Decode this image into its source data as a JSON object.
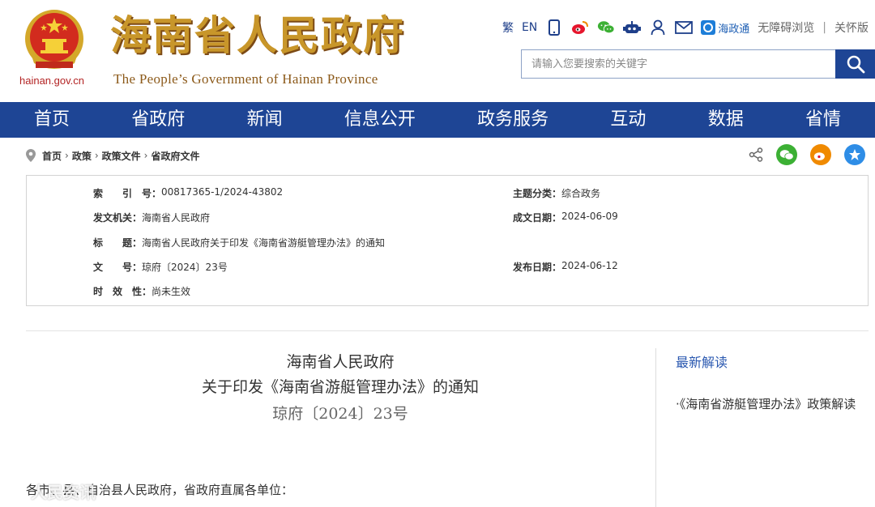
{
  "header": {
    "domain": "hainan.gov.cn",
    "title": "海南省人民政府",
    "subtitle": "The People’s Government  of Hainan Province",
    "tools": {
      "traditional": "繁",
      "english": "EN",
      "haizhengtong": "海政通",
      "accessibility": "无障碍浏览",
      "separator": "|",
      "elder_mode": "关怀版"
    },
    "search": {
      "placeholder": "请输入您要搜索的关键字"
    }
  },
  "nav": [
    "首页",
    "省政府",
    "新闻",
    "信息公开",
    "政务服务",
    "互动",
    "数据",
    "省情"
  ],
  "breadcrumb": [
    "首页",
    "政策",
    "政策文件",
    "省政府文件"
  ],
  "info": {
    "index_label": "索　　引　号：",
    "index_value": "00817365-1/2024-43802",
    "topic_label": "主题分类：",
    "topic_value": "综合政务",
    "issuer_label": "发文机关：",
    "issuer_value": "海南省人民政府",
    "date_label": "成文日期：",
    "date_value": "2024-06-09",
    "title_label": "标　　题：",
    "title_value": "海南省人民政府关于印发《海南省游艇管理办法》的通知",
    "docno_label": "文　　号：",
    "docno_value": "琼府〔2024〕23号",
    "pubdate_label": "发布日期：",
    "pubdate_value": "2024-06-12",
    "validity_label": "时　效　性：",
    "validity_value": "尚未生效"
  },
  "document": {
    "title_line1": "海南省人民政府",
    "title_line2": "关于印发《海南省游艇管理办法》的通知",
    "doc_number": "琼府〔2024〕23号",
    "greeting": "各市、县、自治县人民政府，省政府直属各单位："
  },
  "sidebar": {
    "title": "最新解读",
    "link": "·《海南省游艇管理办法》政策解读"
  },
  "watermark": {
    "text": "人民资讯"
  },
  "colors": {
    "nav_bg": "#1e4595",
    "title_gold": "#c8962a",
    "link_blue": "#2a58b0"
  }
}
